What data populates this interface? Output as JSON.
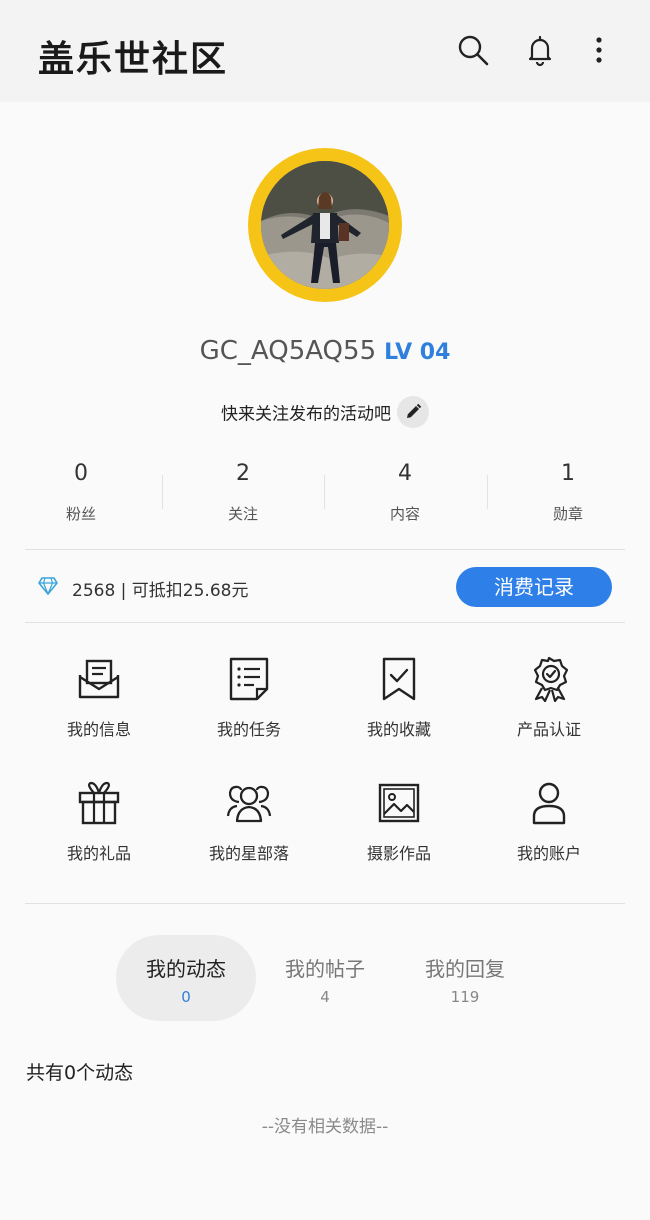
{
  "header": {
    "title": "盖乐世社区",
    "icons": [
      "search-icon",
      "bell-icon",
      "more-vertical-icon"
    ]
  },
  "profile": {
    "username": "GC_AQ5AQ55",
    "level": "LV 04",
    "bio": "快来关注发布的活动吧",
    "ring_color": "#f6c417"
  },
  "stats": [
    {
      "value": "0",
      "label": "粉丝"
    },
    {
      "value": "2",
      "label": "关注"
    },
    {
      "value": "4",
      "label": "内容"
    },
    {
      "value": "1",
      "label": "勋章"
    }
  ],
  "points": {
    "text": "2568 | 可抵扣25.68元",
    "button": "消费记录",
    "accent": "#2f7fe9"
  },
  "menu": [
    {
      "label": "我的信息",
      "icon": "envelope-icon"
    },
    {
      "label": "我的任务",
      "icon": "task-list-icon"
    },
    {
      "label": "我的收藏",
      "icon": "bookmark-check-icon"
    },
    {
      "label": "产品认证",
      "icon": "certified-badge-icon"
    },
    {
      "label": "我的礼品",
      "icon": "gift-icon"
    },
    {
      "label": "我的星部落",
      "icon": "group-icon"
    },
    {
      "label": "摄影作品",
      "icon": "image-icon"
    },
    {
      "label": "我的账户",
      "icon": "user-icon"
    }
  ],
  "tabs": [
    {
      "label": "我的动态",
      "count": "0",
      "active": true
    },
    {
      "label": "我的帖子",
      "count": "4",
      "active": false
    },
    {
      "label": "我的回复",
      "count": "119",
      "active": false
    }
  ],
  "feed": {
    "summary": "共有0个动态",
    "empty_text": "--没有相关数据--"
  }
}
